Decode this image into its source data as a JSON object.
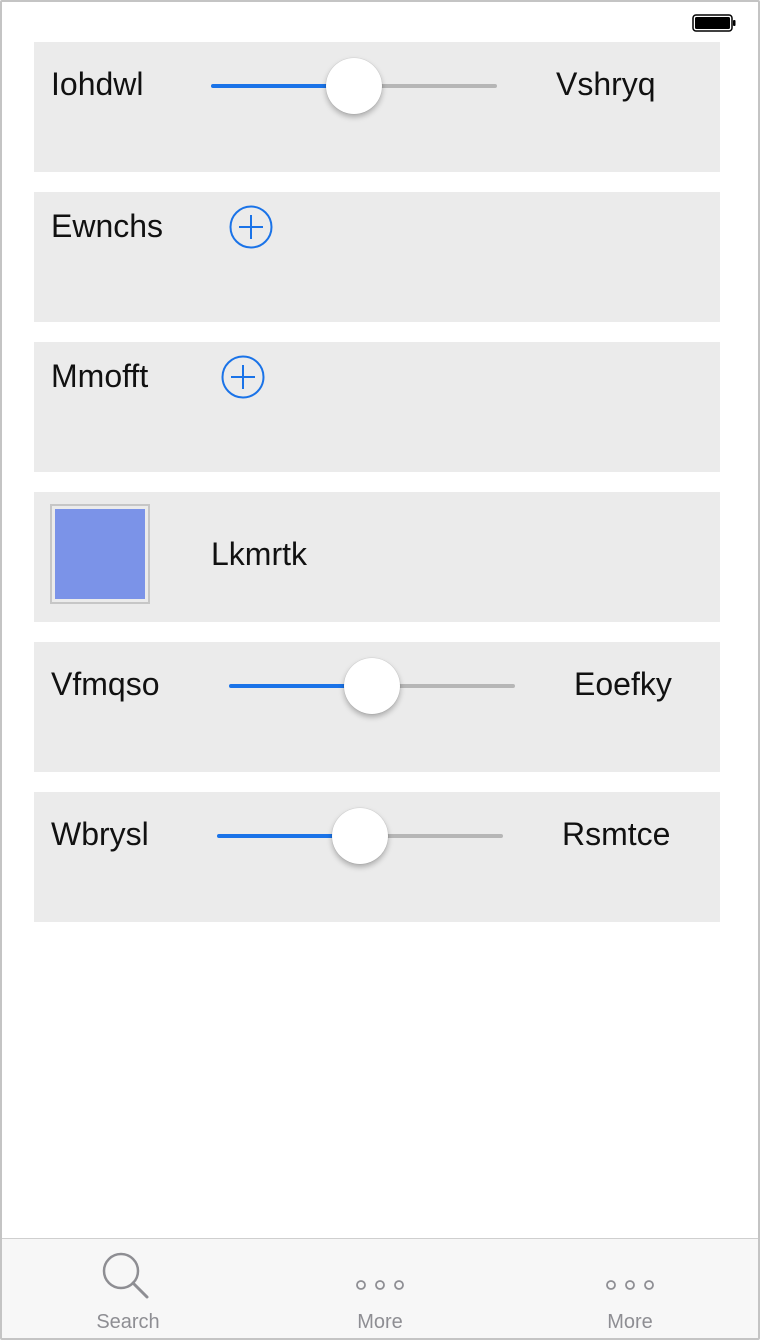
{
  "colors": {
    "accent": "#1a73e8",
    "card_bg": "#ebebeb",
    "swatch": "#7b93e8",
    "tab_inactive": "#8e8e93"
  },
  "status_bar": {
    "battery_icon": "battery-full-icon"
  },
  "rows": {
    "slider1": {
      "left_label": "Iohdwl",
      "right_label": "Vshryq",
      "value": 0.5
    },
    "add1": {
      "label": "Ewnchs",
      "icon": "plus-circle-icon"
    },
    "add2": {
      "label": "Mmofft",
      "icon": "plus-circle-icon"
    },
    "color": {
      "label": "Lkmrtk"
    },
    "slider2": {
      "left_label": "Vfmqso",
      "right_label": "Eoefky",
      "value": 0.5
    },
    "slider3": {
      "left_label": "Wbrysl",
      "right_label": "Rsmtce",
      "value": 0.5
    }
  },
  "tabbar": {
    "tabs": [
      {
        "label": "Search",
        "icon": "search-icon"
      },
      {
        "label": "More",
        "icon": "more-icon"
      },
      {
        "label": "More",
        "icon": "more-icon"
      }
    ]
  }
}
